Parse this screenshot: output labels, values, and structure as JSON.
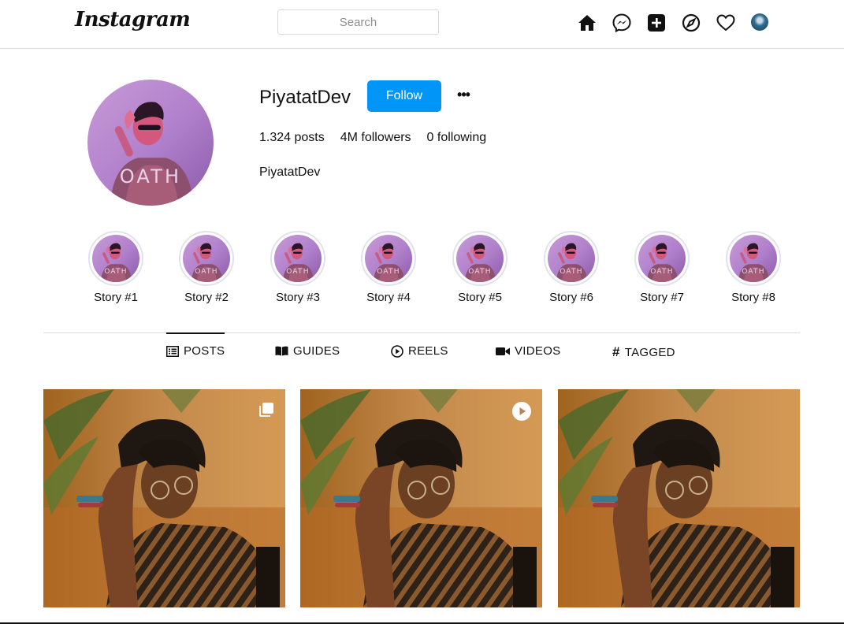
{
  "header": {
    "logo": "Instagram",
    "search_placeholder": "Search",
    "icons": [
      "home-icon",
      "messenger-icon",
      "new-post-icon",
      "explore-icon",
      "activity-heart-icon",
      "profile-avatar"
    ]
  },
  "profile": {
    "username": "PiyatatDev",
    "follow_label": "Follow",
    "more_label": "•••",
    "posts": "1.324 posts",
    "followers": "4M followers",
    "following": "0 following",
    "full_name": "PiyatatDev"
  },
  "stories": [
    {
      "label": "Story #1"
    },
    {
      "label": "Story #2"
    },
    {
      "label": "Story #3"
    },
    {
      "label": "Story #4"
    },
    {
      "label": "Story #5"
    },
    {
      "label": "Story #6"
    },
    {
      "label": "Story #7"
    },
    {
      "label": "Story #8"
    }
  ],
  "tabs": [
    {
      "label": "POSTS",
      "icon": "posts-grid-icon",
      "active": true
    },
    {
      "label": "GUIDES",
      "icon": "book-icon",
      "active": false
    },
    {
      "label": "REELS",
      "icon": "reels-play-icon",
      "active": false
    },
    {
      "label": "VIDEOS",
      "icon": "video-camera-icon",
      "active": false
    },
    {
      "label": "TAGGED",
      "icon": "hashtag-icon",
      "active": false
    }
  ],
  "posts": [
    {
      "badge": "carousel-icon"
    },
    {
      "badge": "video-play-icon"
    },
    {
      "badge": null
    }
  ],
  "colors": {
    "accent": "#0095f6",
    "border": "#dbdbdb",
    "text": "#111111",
    "muted": "#8e8e8e"
  }
}
